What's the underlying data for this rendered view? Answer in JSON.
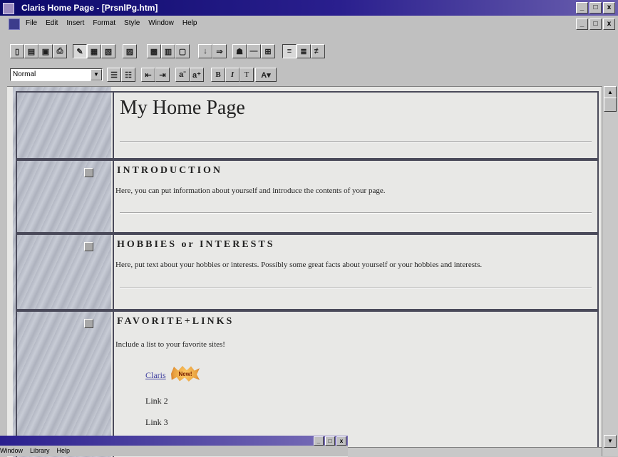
{
  "window": {
    "title": "Claris Home Page - [PrsnlPg.htm]",
    "controls": {
      "minimize": "_",
      "maximize": "□",
      "close": "x"
    }
  },
  "menubar": {
    "items": [
      "File",
      "Edit",
      "Insert",
      "Format",
      "Style",
      "Window",
      "Help"
    ],
    "controls": {
      "minimize": "_",
      "maximize": "□",
      "close": "x"
    }
  },
  "toolbar": {
    "buttons": [
      {
        "name": "new-doc-icon",
        "glyph": "▯"
      },
      {
        "name": "open-icon",
        "glyph": "▤"
      },
      {
        "name": "save-icon",
        "glyph": "▣"
      },
      {
        "name": "print-icon",
        "glyph": "⎙"
      },
      {
        "name": "edit-mode-icon",
        "glyph": "✎"
      },
      {
        "name": "preview-icon",
        "glyph": "▦"
      },
      {
        "name": "html-source-icon",
        "glyph": "▧"
      },
      {
        "name": "document-options-icon",
        "glyph": "▨"
      },
      {
        "name": "insert-table-icon",
        "glyph": "▩"
      },
      {
        "name": "insert-form-icon",
        "glyph": "▥"
      },
      {
        "name": "insert-frame-icon",
        "glyph": "▢"
      },
      {
        "name": "anchor-icon",
        "glyph": "↓"
      },
      {
        "name": "link-icon",
        "glyph": "⇒"
      },
      {
        "name": "insert-image-icon",
        "glyph": "☗"
      },
      {
        "name": "horizontal-rule-icon",
        "glyph": "—"
      },
      {
        "name": "insert-grid-icon",
        "glyph": "⊞"
      },
      {
        "name": "align-left-icon",
        "glyph": "≡"
      },
      {
        "name": "align-center-icon",
        "glyph": "≣"
      },
      {
        "name": "align-right-icon",
        "glyph": "≢"
      }
    ]
  },
  "formatbar": {
    "style_value": "Normal",
    "buttons": [
      {
        "name": "numbered-list-icon",
        "glyph": "☰"
      },
      {
        "name": "bullet-list-icon",
        "glyph": "☷"
      },
      {
        "name": "outdent-icon",
        "glyph": "⇤"
      },
      {
        "name": "indent-icon",
        "glyph": "⇥"
      },
      {
        "name": "decrease-font-icon",
        "glyph": "aˉ"
      },
      {
        "name": "increase-font-icon",
        "glyph": "a⁺"
      },
      {
        "name": "bold-button",
        "glyph": "B"
      },
      {
        "name": "italic-button",
        "glyph": "I"
      },
      {
        "name": "teletype-button",
        "glyph": "T"
      },
      {
        "name": "text-color-button",
        "glyph": "A▾"
      }
    ]
  },
  "page": {
    "title": "My Home Page",
    "sections": [
      {
        "heading": "INTRODUCTION",
        "text": "Here, you can put information about yourself and introduce the contents of your page."
      },
      {
        "heading": "HOBBIES or INTERESTS",
        "text": "Here, put text about your hobbies or interests. Possibly some great facts about yourself or your hobbies and interests."
      },
      {
        "heading": "FAVORITE+LINKS",
        "text": "Include a list to your favorite sites!",
        "links": [
          "Claris",
          "Link 2",
          "Link 3"
        ],
        "badge": "New!"
      }
    ]
  },
  "second_window": {
    "menus": [
      "Window",
      "Library",
      "Help"
    ],
    "controls": {
      "minimize": "_",
      "maximize": "□",
      "close": "x"
    }
  }
}
